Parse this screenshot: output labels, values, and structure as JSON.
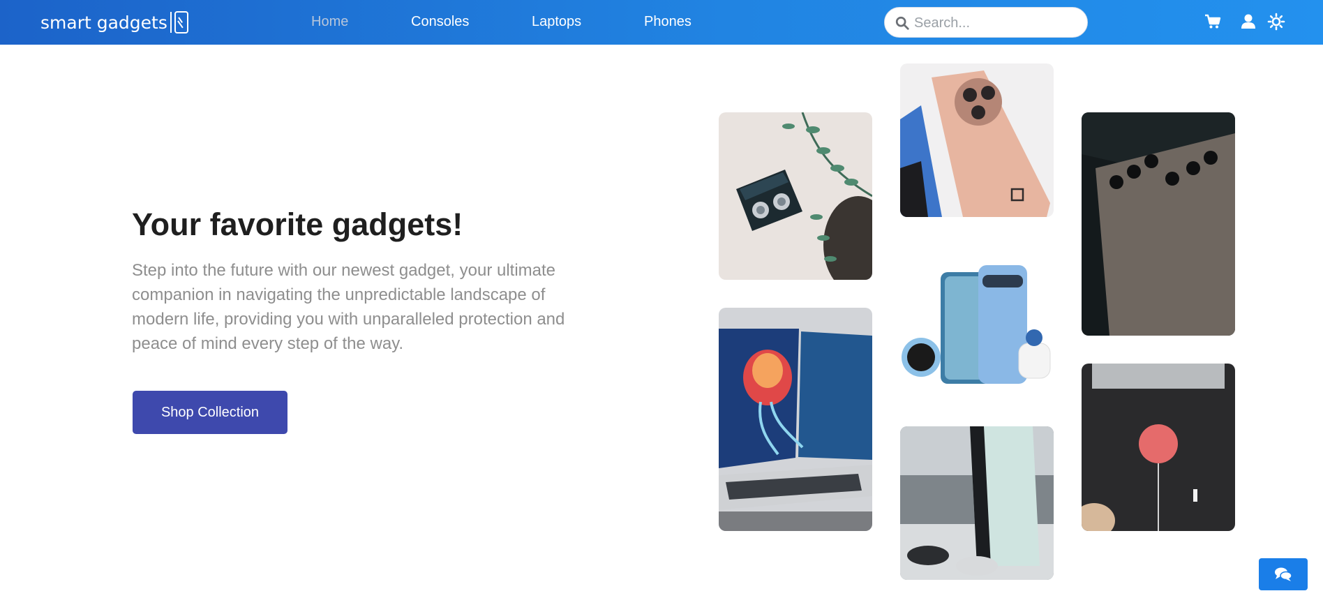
{
  "brand": {
    "name": "smart gadgets"
  },
  "nav": {
    "items": [
      {
        "label": "Home",
        "active": true
      },
      {
        "label": "Consoles"
      },
      {
        "label": "Laptops"
      },
      {
        "label": "Phones"
      }
    ]
  },
  "search": {
    "placeholder": "Search..."
  },
  "header_icons": [
    "cart-icon",
    "user-icon",
    "sun-icon"
  ],
  "hero": {
    "title": "Your favorite gadgets!",
    "description": "Step into the future with our newest gadget, your ultimate companion in navigating the unpredictable landscape of modern life, providing you with unparalleled protection and peace of mind every step of the way.",
    "cta_label": "Shop Collection"
  },
  "gallery": [
    "wireless-earbuds-image",
    "dual-screen-laptop-image",
    "oneplus-phone-image",
    "google-pixel-devices-image",
    "playstation-console-image",
    "samsung-phone-image",
    "speaker-earbuds-image"
  ],
  "colors": {
    "header_start": "#1c63c9",
    "header_end": "#2391ee",
    "button": "#3e49ad",
    "chat_button": "#1a7ee8",
    "title_text": "#1f1f1f",
    "body_text": "#8e8e8e"
  }
}
